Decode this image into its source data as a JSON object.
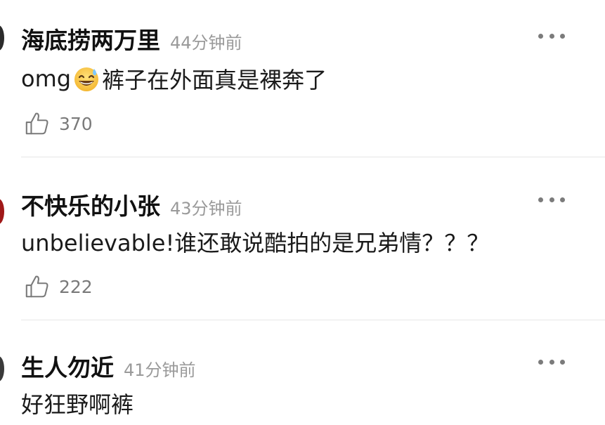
{
  "comments": [
    {
      "username": "海底捞两万里",
      "time": "44分钟前",
      "text_prefix": "omg",
      "emoji": "sweat-smile-emoji",
      "text_suffix": "裤子在外面真是裸奔了",
      "likes": "370"
    },
    {
      "username": "不快乐的小张",
      "time": "43分钟前",
      "text": "unbelievable!谁还敢说酷拍的是兄弟情？？？",
      "likes": "222"
    },
    {
      "username": "生人勿近",
      "time": "41分钟前",
      "text": "好狂野啊裤"
    }
  ],
  "icons": {
    "like": "thumbs-up-icon",
    "more": "more-icon",
    "emoji": "sweat-smile-emoji"
  },
  "colors": {
    "username": "#111111",
    "timestamp": "#9a9a9a",
    "text": "#1a1a1a",
    "like_count": "#7a7a7a",
    "divider": "#e6e6e6",
    "more_dots": "#7b7b7b"
  }
}
